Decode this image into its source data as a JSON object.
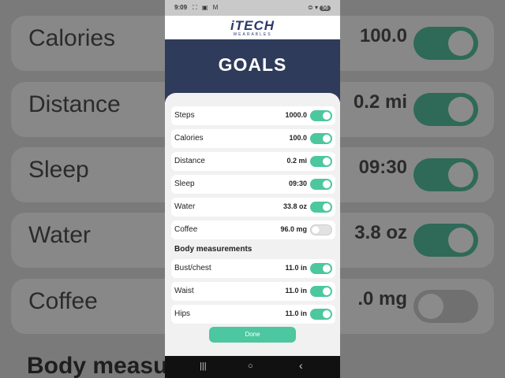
{
  "status": {
    "time": "9:09",
    "left_icons": "⛶ ▣ M",
    "right_icons": "⊜ ▾",
    "battery": "56"
  },
  "brand": {
    "logo": "iTECH",
    "tagline": "WEARABLES"
  },
  "page": {
    "title": "GOALS"
  },
  "goals": [
    {
      "label": "Steps",
      "value": "1000.0",
      "enabled": true
    },
    {
      "label": "Calories",
      "value": "100.0",
      "enabled": true
    },
    {
      "label": "Distance",
      "value": "0.2 mi",
      "enabled": true
    },
    {
      "label": "Sleep",
      "value": "09:30",
      "enabled": true
    },
    {
      "label": "Water",
      "value": "33.8 oz",
      "enabled": true
    },
    {
      "label": "Coffee",
      "value": "96.0 mg",
      "enabled": false
    }
  ],
  "body_section": {
    "heading": "Body measurements",
    "items": [
      {
        "label": "Bust/chest",
        "value": "11.0 in",
        "enabled": true
      },
      {
        "label": "Waist",
        "value": "11.0 in",
        "enabled": true
      },
      {
        "label": "Hips",
        "value": "11.0 in",
        "enabled": true
      }
    ]
  },
  "actions": {
    "done_label": "Done"
  },
  "nav": {
    "recents": "|||",
    "home": "○",
    "back": "‹"
  },
  "background": {
    "rows": [
      {
        "label": "Calories",
        "value": "100.0",
        "enabled": true
      },
      {
        "label": "Distance",
        "value": "0.2 mi",
        "enabled": true
      },
      {
        "label": "Sleep",
        "value": "09:30",
        "enabled": true
      },
      {
        "label": "Water",
        "value": "3.8 oz",
        "enabled": true
      },
      {
        "label": "Coffee",
        "value": ".0 mg",
        "enabled": false
      }
    ],
    "heading": "Body measu"
  },
  "colors": {
    "accent": "#4cc79f",
    "header_band": "#2f3b5a",
    "brand": "#2b3a6d"
  }
}
